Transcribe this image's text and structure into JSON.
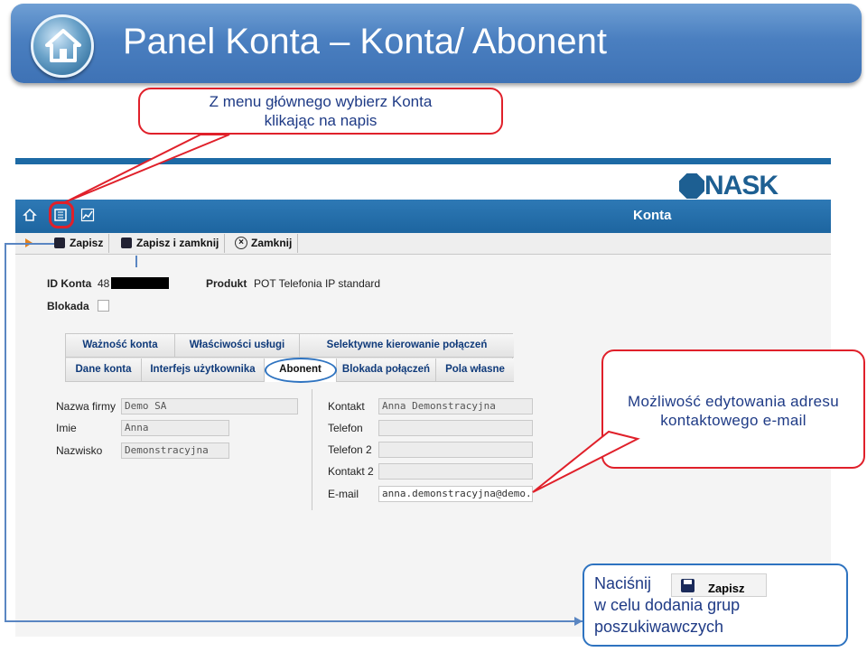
{
  "slide": {
    "title": "Panel Konta –  Konta/ Abonent",
    "callout_top_line1": "Z menu głównego wybierz Konta",
    "callout_top_line2": "klikając na napis",
    "callout_right_line1": "Możliwość edytowania adresu",
    "callout_right_line2": "kontaktowego e-mail",
    "callout_bottom_line1": "Naciśnij",
    "callout_bottom_line2": "w celu dodania grup",
    "callout_bottom_line3": "poszukiwawczych",
    "callout_bottom_button": "Zapisz"
  },
  "app": {
    "logo_text": "NASK",
    "nav_title": "Konta",
    "nav_icons": [
      "home-icon",
      "list-icon",
      "chart-icon"
    ],
    "toolbar": {
      "save": "Zapisz",
      "save_close": "Zapisz i zamknij",
      "close": "Zamknij"
    },
    "header": {
      "id_label": "ID Konta",
      "id_value": "48",
      "product_label": "Produkt",
      "product_value": "POT Telefonia IP standard",
      "block_label": "Blokada"
    },
    "tabs_row1": [
      "Ważność konta",
      "Właściwości usługi",
      "Selektywne kierowanie połączeń"
    ],
    "tabs_row2": [
      "Dane konta",
      "Interfejs użytkownika",
      "Abonent",
      "Blokada połączeń",
      "Pola własne"
    ],
    "active_tab": "Abonent",
    "form_left": [
      {
        "label": "Nazwa firmy",
        "value": "Demo SA"
      },
      {
        "label": "Imie",
        "value": "Anna"
      },
      {
        "label": "Nazwisko",
        "value": "Demonstracyjna"
      }
    ],
    "form_right": [
      {
        "label": "Kontakt",
        "value": "Anna Demonstracyjna"
      },
      {
        "label": "Telefon",
        "value": ""
      },
      {
        "label": "Telefon 2",
        "value": ""
      },
      {
        "label": "Kontakt 2",
        "value": ""
      },
      {
        "label": "E-mail",
        "value": "anna.demonstracyjna@demo."
      }
    ]
  },
  "colors": {
    "callout_red": "#e0202a",
    "callout_blue": "#2e73c0",
    "title_blue": "#4a7fc0",
    "nav_blue": "#1d65a0"
  }
}
